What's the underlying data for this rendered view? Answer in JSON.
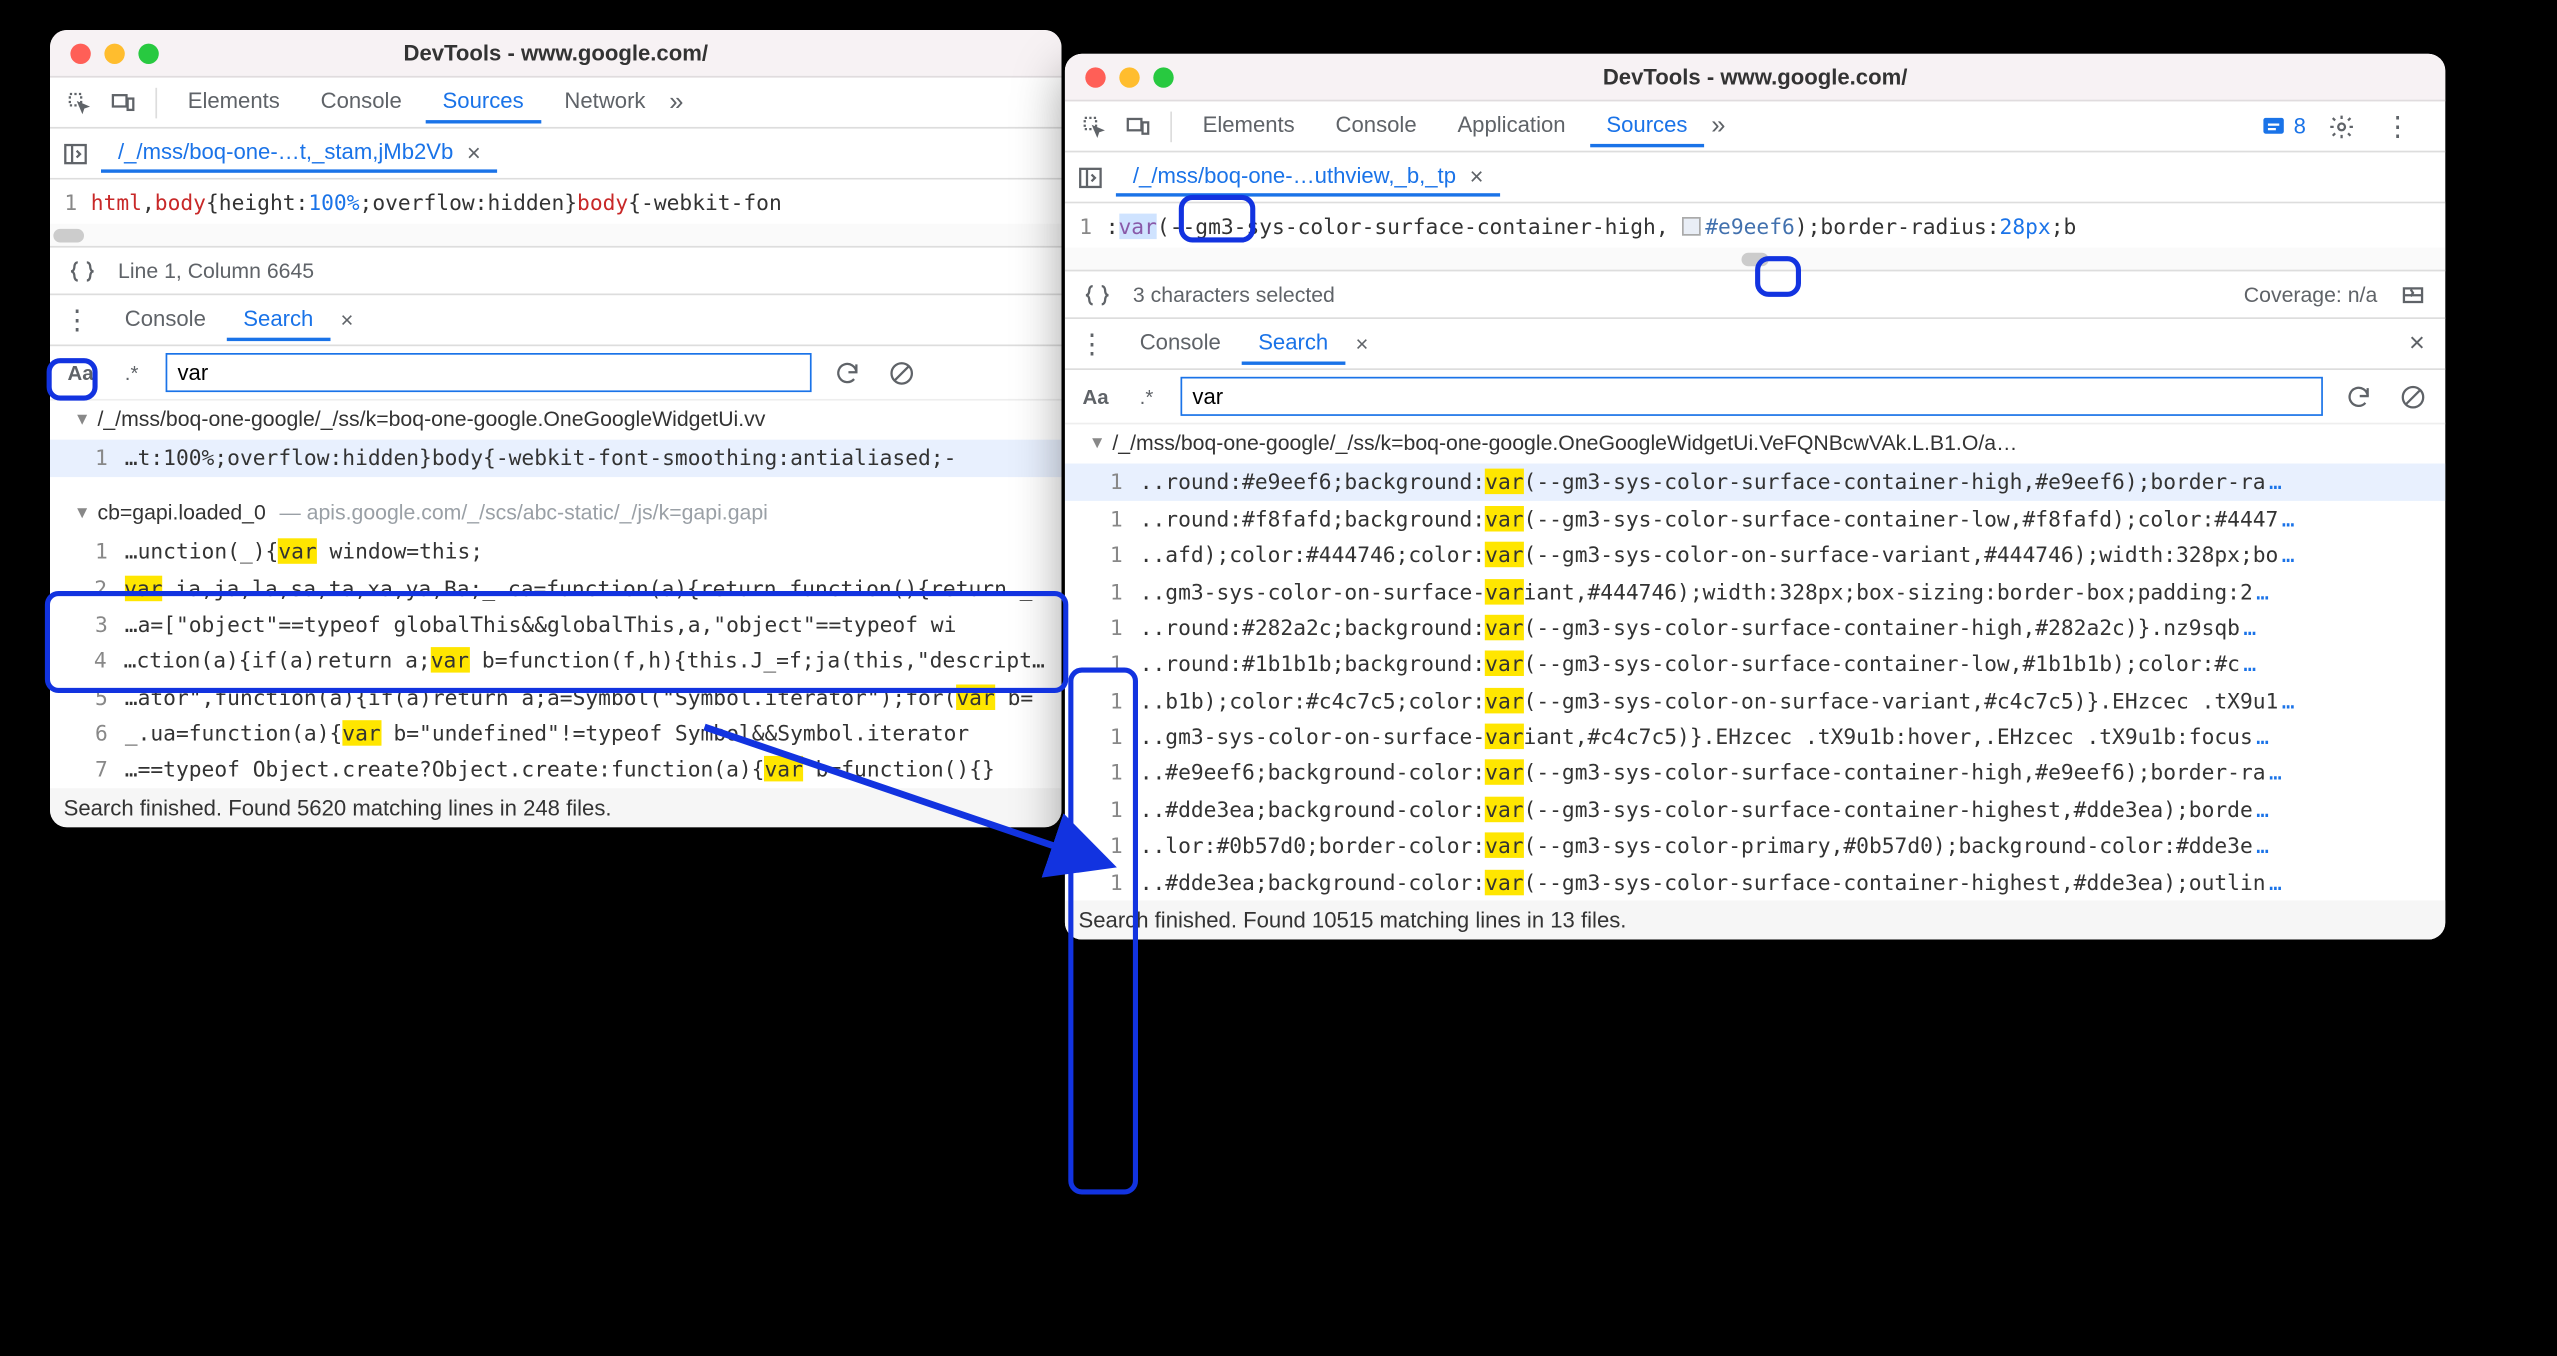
{
  "left": {
    "title": "DevTools - www.google.com/",
    "tabs": {
      "elements": "Elements",
      "console": "Console",
      "sources": "Sources",
      "network": "Network"
    },
    "filetab": "/_/mss/boq-one-…t,_stam,jMb2Vb",
    "editor": {
      "lineNum": "1",
      "code_a": "html",
      "code_comma": ",",
      "code_b": "body",
      "code_open": "{",
      "code_prop": "height:",
      "code_val": "100%",
      "code_sc1": ";",
      "code_prop2": "overflow:",
      "code_val2": "hidden",
      "code_close": "}",
      "code_c": "body",
      "code_open2": "{",
      "code_prop3": "-webkit-fon"
    },
    "status": "Line 1, Column 6645",
    "drawer": {
      "console": "Console",
      "search": "Search"
    },
    "searchQuery": "var",
    "resultsA": {
      "file": "/_/mss/boq-one-google/_/ss/k=boq-one-google.OneGoogleWidgetUi.vv",
      "line1": {
        "num": "1",
        "pre": "…t:100%;overflow:hidden}body{-webkit-font-smoothing:antialiased;-"
      }
    },
    "resultsB": {
      "file": "cb=gapi.loaded_0",
      "host": "apis.google.com/_/scs/abc-static/_/js/k=gapi.gapi",
      "rows": [
        {
          "num": "1",
          "pre": "…unction(_){",
          "hl": "var",
          "post": " window=this;"
        },
        {
          "num": "2",
          "pre": "",
          "hl": "var",
          "post": " ia,ja,la,sa,ta,xa,ya,Ba;_.ca=function(a){return function(){return _.ba"
        },
        {
          "num": "3",
          "pre": "…a=[\"object\"==typeof globalThis&&globalThis,a,\"object\"==typeof wi",
          "hl": "",
          "post": ""
        },
        {
          "num": "4",
          "pre": "…ction(a){if(a)return a;",
          "hl": "var",
          "post": " b=function(f,h){this.J_=f;ja(this,\"description\""
        },
        {
          "num": "5",
          "pre": "…ator\",function(a){if(a)return a;a=Symbol(\"Symbol.iterator\");for(",
          "hl": "var",
          "post": " b="
        },
        {
          "num": "6",
          "pre": "_.ua=function(a){",
          "hl": "var",
          "post": " b=\"undefined\"!=typeof Symbol&&Symbol.iterator"
        },
        {
          "num": "7",
          "pre": "…==typeof Object.create?Object.create:function(a){",
          "hl": "var",
          "post": " b=function(){}"
        }
      ]
    },
    "footer": "Search finished.  Found 5620 matching lines in 248 files."
  },
  "right": {
    "title": "DevTools - www.google.com/",
    "tabs": {
      "elements": "Elements",
      "console": "Console",
      "application": "Application",
      "sources": "Sources"
    },
    "badgeCount": "8",
    "filetab": "/_/mss/boq-one-…uthview,_b,_tp",
    "editor": {
      "lineNum": "1",
      "code_a": ":",
      "code_var": "var",
      "code_open": "(",
      "code_css": "--gm3-sys-color-surface-container-high,",
      "code_hex": "#e9eef6",
      "code_close": ");",
      "code_prop": "border-radius:",
      "code_val": "28px",
      "code_end": ";b"
    },
    "status": "3 characters selected",
    "coverage": "Coverage: n/a",
    "drawer": {
      "console": "Console",
      "search": "Search"
    },
    "searchQuery": "var",
    "resultsFile": "/_/mss/boq-one-google/_/ss/k=boq-one-google.OneGoogleWidgetUi.VeFQNBcwVAk.L.B1.O/a…",
    "rows": [
      {
        "num": "1",
        "pre": "..round:#e9eef6;background:",
        "hl": "var",
        "post": "(--gm3-sys-color-surface-container-high,#e9eef6);border-ra"
      },
      {
        "num": "1",
        "pre": "..round:#f8fafd;background:",
        "hl": "var",
        "post": "(--gm3-sys-color-surface-container-low,#f8fafd);color:#4447"
      },
      {
        "num": "1",
        "pre": "..afd);color:#444746;color:",
        "hl": "var",
        "post": "(--gm3-sys-color-on-surface-variant,#444746);width:328px;bo"
      },
      {
        "num": "1",
        "pre": "..gm3-sys-color-on-surface-",
        "hl": "var",
        "post": "iant,#444746);width:328px;box-sizing:border-box;padding:2"
      },
      {
        "num": "1",
        "pre": "..round:#282a2c;background:",
        "hl": "var",
        "post": "(--gm3-sys-color-surface-container-high,#282a2c)}.nz9sqb"
      },
      {
        "num": "1",
        "pre": "..round:#1b1b1b;background:",
        "hl": "var",
        "post": "(--gm3-sys-color-surface-container-low,#1b1b1b);color:#c"
      },
      {
        "num": "1",
        "pre": "..b1b);color:#c4c7c5;color:",
        "hl": "var",
        "post": "(--gm3-sys-color-on-surface-variant,#c4c7c5)}.EHzcec .tX9u1"
      },
      {
        "num": "1",
        "pre": "..gm3-sys-color-on-surface-",
        "hl": "var",
        "post": "iant,#c4c7c5)}.EHzcec .tX9u1b:hover,.EHzcec .tX9u1b:focus"
      },
      {
        "num": "1",
        "pre": "..#e9eef6;background-color:",
        "hl": "var",
        "post": "(--gm3-sys-color-surface-container-high,#e9eef6);border-ra"
      },
      {
        "num": "1",
        "pre": "..#dde3ea;background-color:",
        "hl": "var",
        "post": "(--gm3-sys-color-surface-container-highest,#dde3ea);borde"
      },
      {
        "num": "1",
        "pre": "..lor:#0b57d0;border-color:",
        "hl": "var",
        "post": "(--gm3-sys-color-primary,#0b57d0);background-color:#dde3e"
      },
      {
        "num": "1",
        "pre": "..#dde3ea;background-color:",
        "hl": "var",
        "post": "(--gm3-sys-color-surface-container-highest,#dde3ea);outlin"
      }
    ],
    "footer": "Search finished.  Found 10515 matching lines in 13 files."
  }
}
